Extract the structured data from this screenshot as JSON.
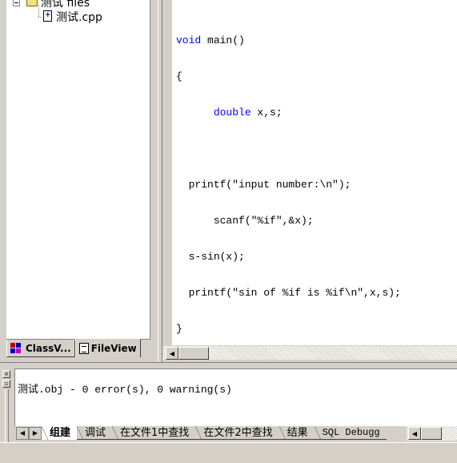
{
  "workspace": {
    "tree": {
      "root_label": "测试 files",
      "file_label": "测试.cpp"
    },
    "tabs": [
      {
        "label": "ClassV...",
        "icon": "classview-icon",
        "active": false
      },
      {
        "label": "FileView",
        "icon": "fileview-icon",
        "active": true
      }
    ]
  },
  "editor": {
    "lines": [
      {
        "indent": "",
        "keyword": "void",
        "rest": " main()"
      },
      {
        "indent": "",
        "keyword": "",
        "rest": "{"
      },
      {
        "indent": "      ",
        "keyword": "double",
        "rest": " x,s;"
      },
      {
        "indent": "",
        "keyword": "",
        "rest": ""
      },
      {
        "indent": "  ",
        "keyword": "",
        "rest": "printf(\"input number:\\n\");"
      },
      {
        "indent": "      ",
        "keyword": "",
        "rest": "scanf(\"%if\",&x);"
      },
      {
        "indent": "  ",
        "keyword": "",
        "rest": "s-sin(x);"
      },
      {
        "indent": "  ",
        "keyword": "",
        "rest": "printf(\"sin of %if is %if\\n\",x,s);"
      },
      {
        "indent": "",
        "keyword": "",
        "rest": "}"
      }
    ],
    "keyword_color": "#0000ff"
  },
  "output": {
    "message": "测试.obj - 0 error(s), 0 warning(s)",
    "tabs": [
      {
        "label": "组建",
        "active": true
      },
      {
        "label": "调试",
        "active": false
      },
      {
        "label": "在文件1中查找",
        "active": false
      },
      {
        "label": "在文件2中查找",
        "active": false
      },
      {
        "label": "结果",
        "active": false
      },
      {
        "label": "SQL Debugg",
        "active": false
      }
    ]
  }
}
